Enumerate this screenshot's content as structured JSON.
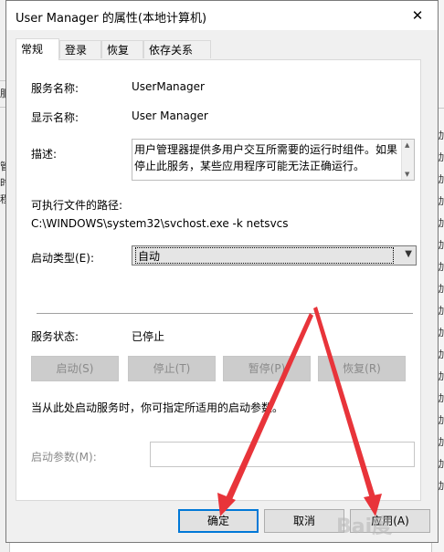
{
  "window": {
    "title": "User Manager 的属性(本地计算机)",
    "close_glyph": "✕"
  },
  "tabs": [
    "常规",
    "登录",
    "恢复",
    "依存关系"
  ],
  "general": {
    "service_name_label": "服务名称:",
    "service_name": "UserManager",
    "display_name_label": "显示名称:",
    "display_name": "User Manager",
    "description_label": "描述:",
    "description_lines": [
      "用户管理器提供多用户交互所需要的运行时组件。如果",
      "停止此服务，某些应用程序可能无法正确运行。"
    ],
    "path_label": "可执行文件的路径:",
    "path": "C:\\WINDOWS\\system32\\svchost.exe -k netsvcs",
    "startup_type_label": "启动类型(E):",
    "startup_type_value": "自动",
    "status_label": "服务状态:",
    "status_value": "已停止",
    "buttons": {
      "start": "启动(S)",
      "stop": "停止(T)",
      "pause": "暂停(P)",
      "resume": "恢复(R)"
    },
    "hint": "当从此处启动服务时，你可指定所适用的启动参数。",
    "start_params_label": "启动参数(M):"
  },
  "footer": {
    "ok": "确定",
    "cancel": "取消",
    "apply": "应用(A)"
  },
  "background": {
    "left_texts": [
      "服",
      "管",
      "时",
      "程"
    ],
    "right_glyph": "动"
  },
  "watermark": "Bai度",
  "colors": {
    "annotation_red": "#e8343a",
    "accent_blue": "#0078d7"
  }
}
